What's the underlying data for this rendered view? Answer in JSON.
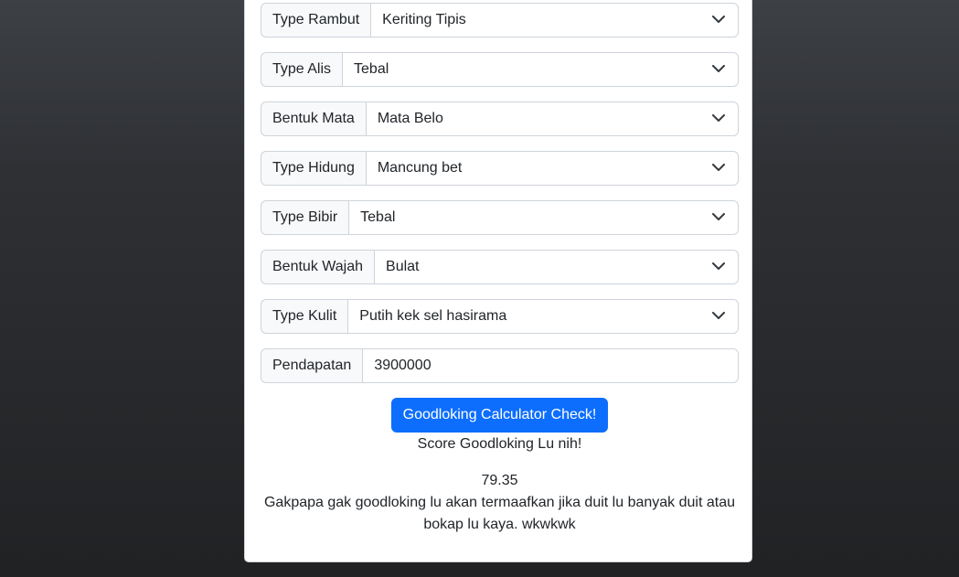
{
  "form": {
    "fields": [
      {
        "label": "Type Rambut",
        "value": "Keriting Tipis"
      },
      {
        "label": "Type Alis",
        "value": "Tebal"
      },
      {
        "label": "Bentuk Mata",
        "value": "Mata Belo"
      },
      {
        "label": "Type Hidung",
        "value": "Mancung bet"
      },
      {
        "label": "Type Bibir",
        "value": "Tebal"
      },
      {
        "label": "Bentuk Wajah",
        "value": "Bulat"
      },
      {
        "label": "Type Kulit",
        "value": "Putih kek sel hasirama"
      }
    ],
    "income": {
      "label": "Pendapatan",
      "value": "3900000"
    }
  },
  "button": {
    "label": "Goodloking Calculator Check!"
  },
  "result": {
    "title": "Score Goodloking Lu nih!",
    "score": "79.35",
    "message": "Gakpapa gak goodloking lu akan termaafkan jika duit lu banyak duit atau bokap lu kaya. wkwkwk"
  },
  "colors": {
    "primary": "#0d6efd",
    "addon_bg": "#f8f9fa",
    "border": "#ced4da"
  }
}
